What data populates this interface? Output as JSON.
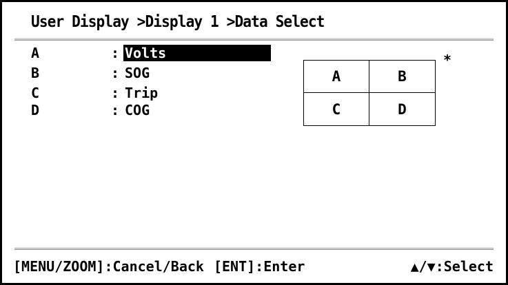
{
  "header": {
    "breadcrumb": "User Display >Display 1 >Data Select"
  },
  "data_select": {
    "rows": [
      {
        "key": "A",
        "colon": ":",
        "value": "Volts",
        "selected": true
      },
      {
        "key": "B",
        "colon": ":",
        "value": "SOG",
        "selected": false
      },
      {
        "key": "C",
        "colon": ":",
        "value": "Trip",
        "selected": false
      },
      {
        "key": "D",
        "colon": ":",
        "value": "COG",
        "selected": false
      }
    ],
    "asterisk": "*"
  },
  "layout_preview": {
    "cells": [
      "A",
      "B",
      "C",
      "D"
    ]
  },
  "footer": {
    "menu_key": "[MENU/ZOOM]",
    "menu_action": ":Cancel/Back",
    "ent_key": "[ENT]",
    "ent_action": ":Enter",
    "arrows": "▲/▼",
    "arrows_action": ":Select"
  },
  "colors": {
    "background": "#ffffff",
    "foreground": "#000000",
    "highlight_bg": "#000000",
    "highlight_fg": "#ffffff",
    "rule": "#c8c8c8"
  }
}
